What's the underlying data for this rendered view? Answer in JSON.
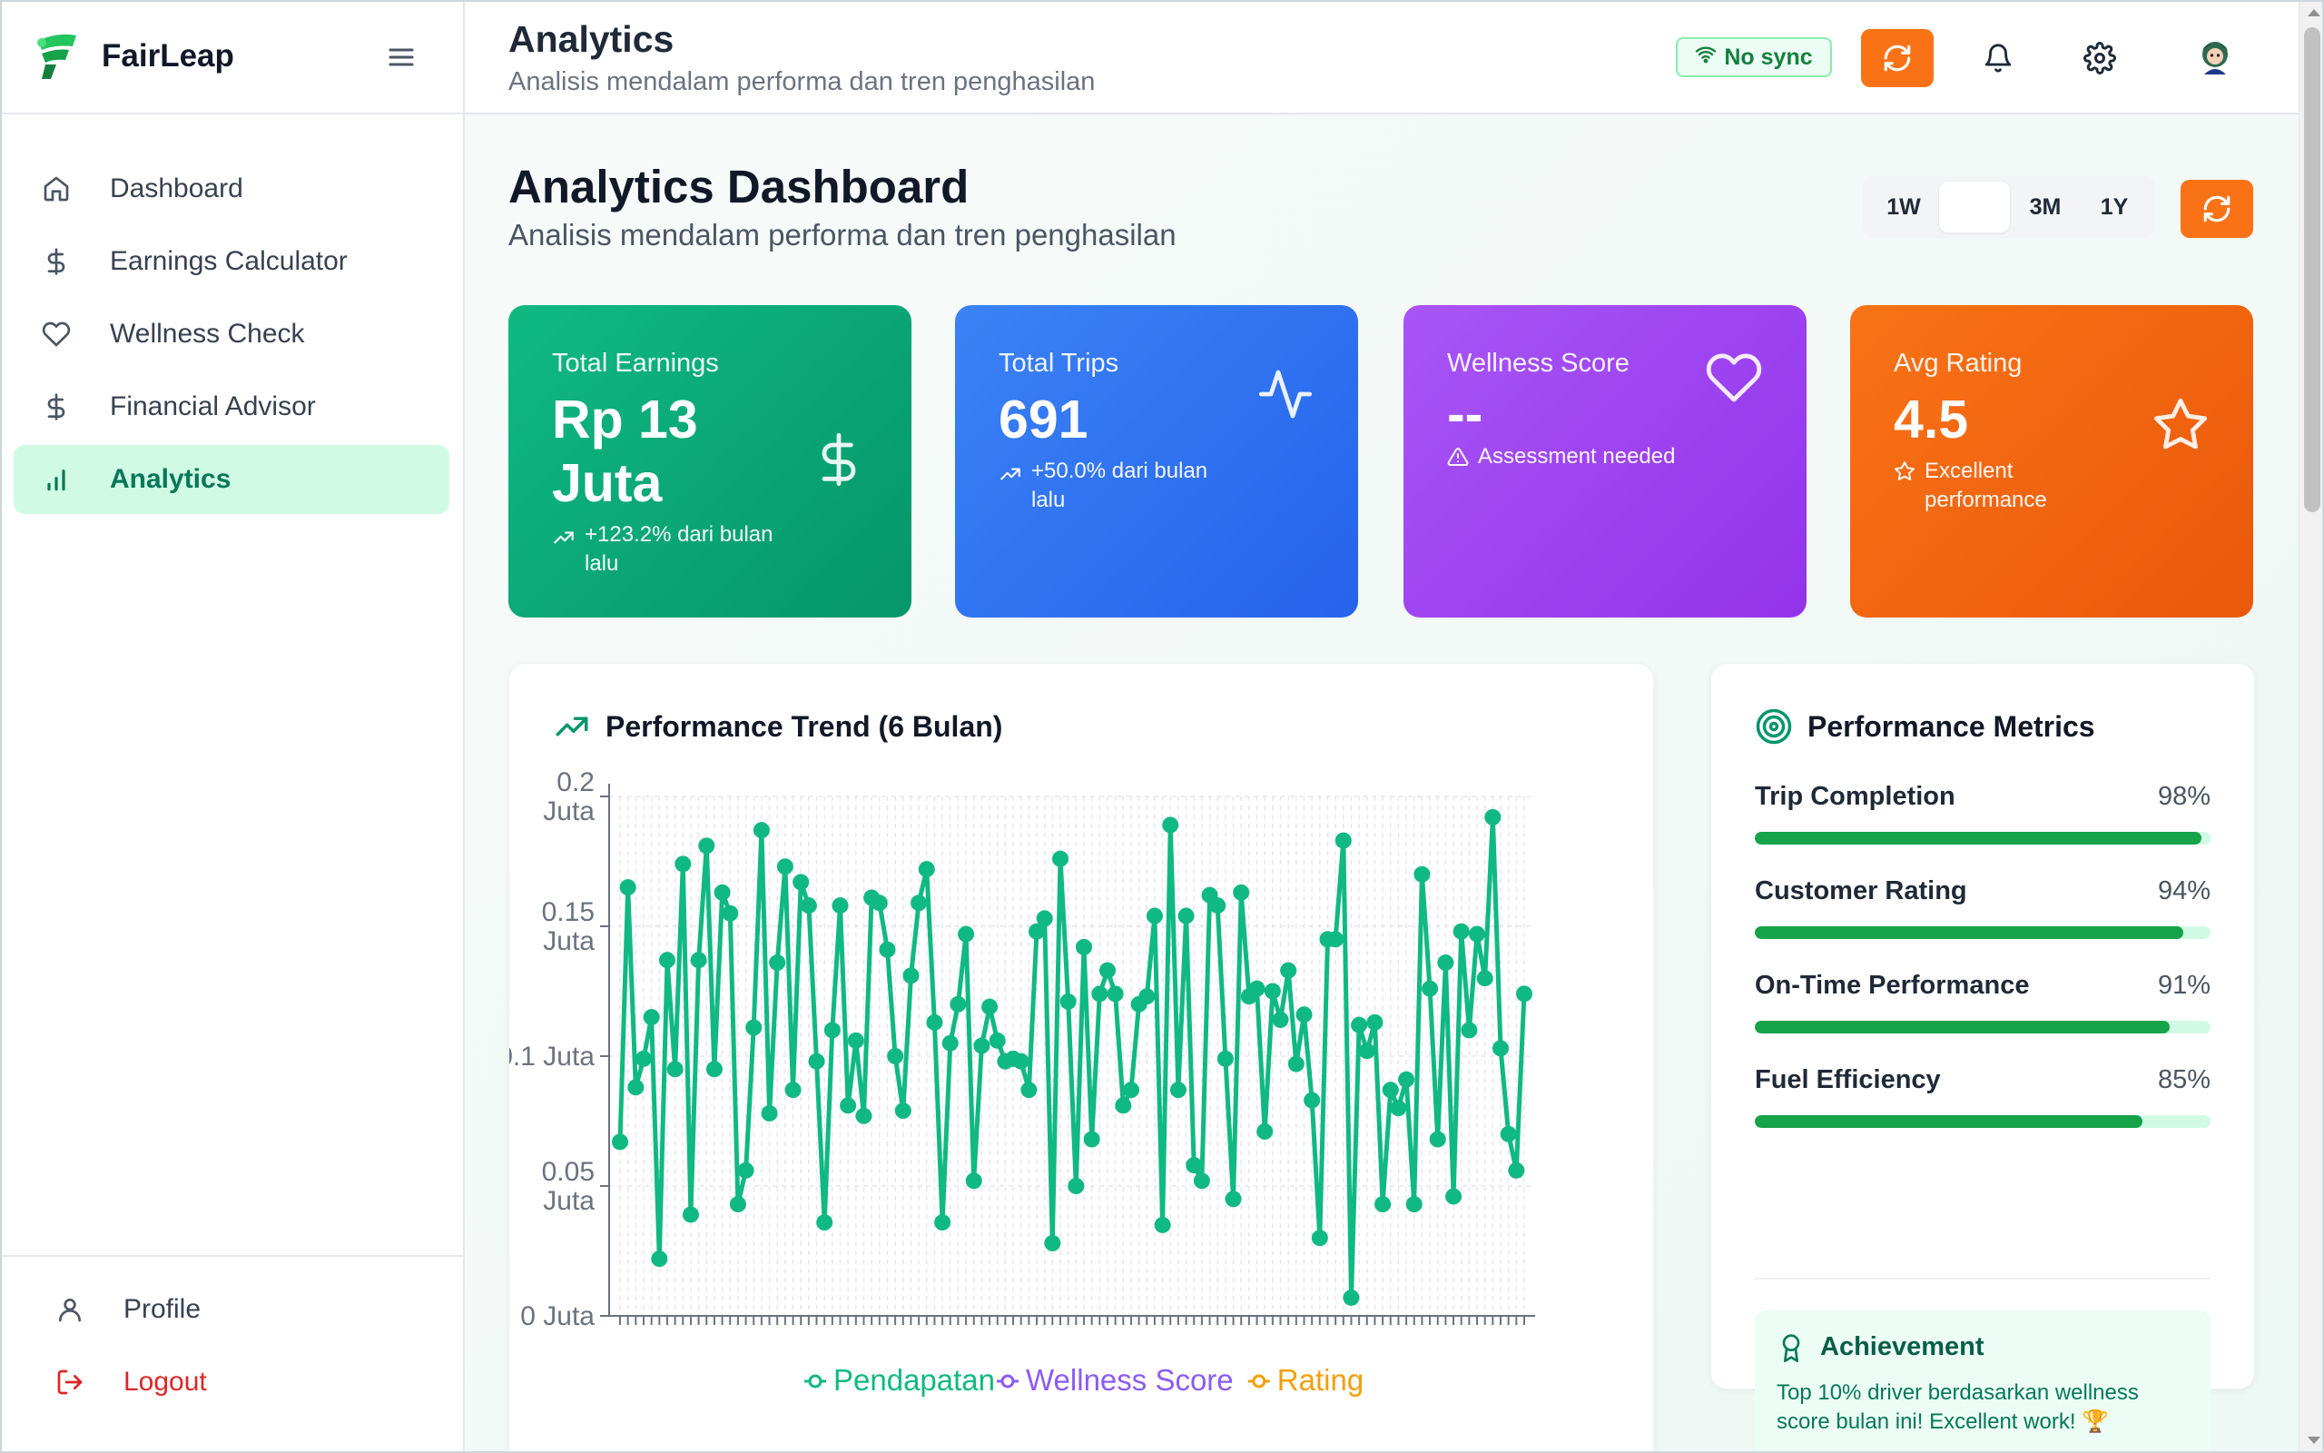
{
  "brand": {
    "name": "FairLeap"
  },
  "sidebar": {
    "items": [
      {
        "label": "Dashboard",
        "icon": "home-icon"
      },
      {
        "label": "Earnings Calculator",
        "icon": "dollar-icon"
      },
      {
        "label": "Wellness Check",
        "icon": "heart-icon"
      },
      {
        "label": "Financial Advisor",
        "icon": "dollar-icon"
      },
      {
        "label": "Analytics",
        "icon": "bar-chart-icon",
        "active": true
      }
    ],
    "bottom": [
      {
        "label": "Profile",
        "icon": "user-icon"
      },
      {
        "label": "Logout",
        "icon": "logout-icon"
      }
    ]
  },
  "topbar": {
    "title": "Analytics",
    "subtitle": "Analisis mendalam performa dan tren penghasilan",
    "sync_label": "No sync"
  },
  "page": {
    "title": "Analytics Dashboard",
    "subtitle": "Analisis mendalam performa dan tren penghasilan",
    "ranges": [
      "1W",
      "",
      "3M",
      "1Y"
    ],
    "selected_range_index": 1
  },
  "cards": [
    {
      "label": "Total Earnings",
      "value": "Rp 13 Juta",
      "delta": "+123.2% dari bulan lalu",
      "icon": "dollar-icon",
      "color": "#10b981"
    },
    {
      "label": "Total Trips",
      "value": "691",
      "delta": "+50.0% dari bulan lalu",
      "icon": "activity-icon",
      "color": "#3b82f6"
    },
    {
      "label": "Wellness Score",
      "value": "--",
      "delta": "Assessment needed",
      "icon": "heart-icon",
      "color": "#a855f7"
    },
    {
      "label": "Avg Rating",
      "value": "4.5",
      "delta": "Excellent performance",
      "icon": "star-icon",
      "color": "#f97316"
    }
  ],
  "trend": {
    "title": "Performance Trend (6 Bulan)"
  },
  "chart_data": {
    "type": "line",
    "y_ticks": [
      "0 Juta",
      "0.05 Juta",
      "0.1 Juta",
      "0.15 Juta",
      "0.2 Juta"
    ],
    "ylim": [
      0,
      0.2
    ],
    "grid": true,
    "legend_position": "bottom",
    "series": [
      {
        "name": "Pendapatan",
        "color": "#10b981",
        "values": [
          0.067,
          0.165,
          0.088,
          0.099,
          0.115,
          0.022,
          0.137,
          0.095,
          0.174,
          0.039,
          0.137,
          0.181,
          0.095,
          0.163,
          0.155,
          0.043,
          0.056,
          0.111,
          0.187,
          0.078,
          0.136,
          0.173,
          0.087,
          0.167,
          0.158,
          0.098,
          0.036,
          0.11,
          0.158,
          0.081,
          0.106,
          0.077,
          0.161,
          0.159,
          0.141,
          0.1,
          0.079,
          0.131,
          0.159,
          0.172,
          0.113,
          0.036,
          0.105,
          0.12,
          0.147,
          0.052,
          0.104,
          0.119,
          0.106,
          0.098,
          0.099,
          0.098,
          0.087,
          0.148,
          0.153,
          0.028,
          0.176,
          0.121,
          0.05,
          0.142,
          0.068,
          0.124,
          0.133,
          0.124,
          0.081,
          0.087,
          0.12,
          0.123,
          0.154,
          0.035,
          0.189,
          0.087,
          0.154,
          0.058,
          0.052,
          0.162,
          0.158,
          0.099,
          0.045,
          0.163,
          0.123,
          0.126,
          0.071,
          0.125,
          0.114,
          0.133,
          0.097,
          0.116,
          0.083,
          0.03,
          0.145,
          0.145,
          0.183,
          0.007,
          0.112,
          0.102,
          0.113,
          0.043,
          0.087,
          0.08,
          0.091,
          0.043,
          0.17,
          0.126,
          0.068,
          0.136,
          0.046,
          0.148,
          0.11,
          0.147,
          0.13,
          0.192,
          0.103,
          0.07,
          0.056,
          0.124
        ]
      },
      {
        "name": "Wellness Score",
        "color": "#8b5cf6",
        "values": []
      },
      {
        "name": "Rating",
        "color": "#f59e0b",
        "values": []
      }
    ]
  },
  "metrics": {
    "title": "Performance Metrics",
    "items": [
      {
        "name": "Trip Completion",
        "pct_label": "98%",
        "value": 0.98
      },
      {
        "name": "Customer Rating",
        "pct_label": "94%",
        "value": 0.94
      },
      {
        "name": "On-Time Performance",
        "pct_label": "91%",
        "value": 0.91
      },
      {
        "name": "Fuel Efficiency",
        "pct_label": "85%",
        "value": 0.85
      }
    ],
    "achievement_title": "Achievement",
    "achievement_text": "Top 10% driver berdasarkan wellness score bulan ini! Excellent work! 🏆"
  }
}
